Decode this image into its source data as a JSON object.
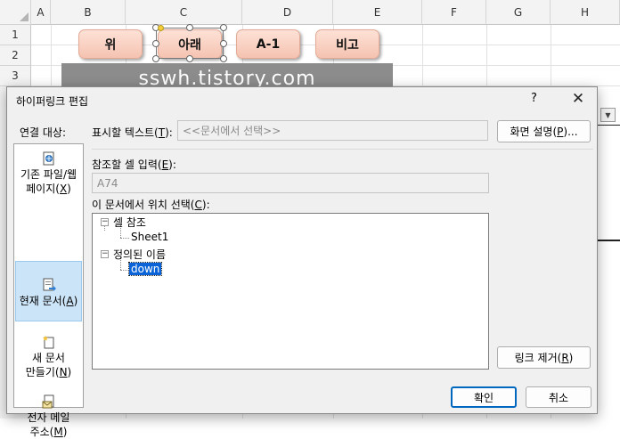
{
  "sheet": {
    "columns": [
      "A",
      "B",
      "C",
      "D",
      "E",
      "F",
      "G",
      "H"
    ],
    "rows": [
      "1",
      "2",
      "3"
    ],
    "buttons": [
      "위",
      "아래",
      "A-1",
      "비고"
    ],
    "banner": "sswh.tistory.com"
  },
  "dialog": {
    "title": "하이퍼링크 편집",
    "help": "?",
    "close": "✕",
    "link_to_label": "연결 대상:",
    "link_types": [
      {
        "line1": "기존 파일/웹",
        "line2": "페이지(",
        "key": "X",
        "suffix": ")"
      },
      {
        "line1": "현재 문서(",
        "key": "A",
        "suffix": ")"
      },
      {
        "line1": "새 문서",
        "line2": "만들기(",
        "key": "N",
        "suffix": ")"
      },
      {
        "line1": "전자 메일",
        "line2": "주소(",
        "key": "M",
        "suffix": ")"
      }
    ],
    "display_text_label": "표시할 텍스트(",
    "display_text_key": "T",
    "display_text_suffix": "):",
    "display_text_value": "<<문서에서 선택>>",
    "screentip_label": "화면 설명(",
    "screentip_key": "P",
    "screentip_suffix": ")...",
    "cell_ref_label": "참조할 셀 입력(",
    "cell_ref_key": "E",
    "cell_ref_suffix": "):",
    "cell_ref_value": "A74",
    "place_label": "이 문서에서 위치 선택(",
    "place_key": "C",
    "place_suffix": "):",
    "tree": {
      "node1": "셀 참조",
      "node1_child": "Sheet1",
      "node2": "정의된 이름",
      "node2_child": "down",
      "expander": "−"
    },
    "remove_link_label": "링크 제거(",
    "remove_link_key": "R",
    "remove_link_suffix": ")",
    "ok_label": "확인",
    "cancel_label": "취소"
  }
}
